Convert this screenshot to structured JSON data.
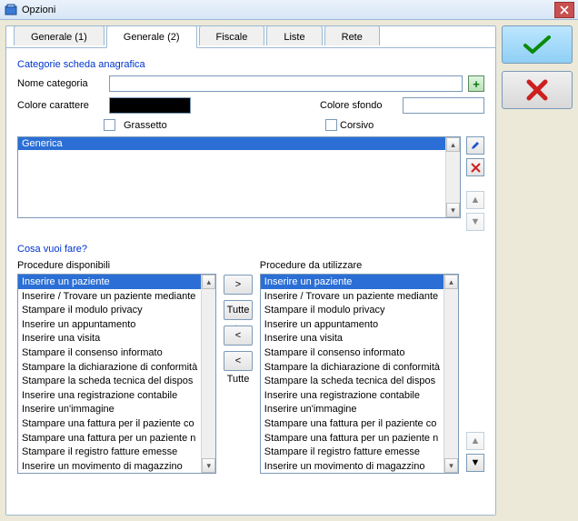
{
  "window": {
    "title": "Opzioni"
  },
  "tabs": [
    "Generale (1)",
    "Generale (2)",
    "Fiscale",
    "Liste",
    "Rete"
  ],
  "active_tab": 1,
  "section_categories_title": "Categorie scheda anagrafica",
  "labels": {
    "nome_categoria": "Nome categoria",
    "colore_carattere": "Colore carattere",
    "colore_sfondo": "Colore sfondo",
    "grassetto": "Grassetto",
    "corsivo": "Corsivo"
  },
  "category_name_value": "",
  "color_char": "#000000",
  "color_bg": "#ffffff",
  "category_list": [
    {
      "label": "Generica",
      "selected": true
    }
  ],
  "section_cosa_title": "Cosa vuoi fare?",
  "available_header": "Procedure disponibili",
  "used_header": "Procedure da utilizzare",
  "move_buttons": {
    "add": ">",
    "add_all": "Tutte >",
    "remove": "<",
    "remove_all": "< Tutte"
  },
  "procedures_available": [
    "Inserire un paziente",
    "Inserire / Trovare un paziente mediante",
    "Stampare il modulo privacy",
    "Inserire un appuntamento",
    "Inserire una visita",
    "Stampare il consenso informato",
    "Stampare la dichiarazione di conformità",
    "Stampare la scheda tecnica del dispos",
    "Inserire una registrazione contabile",
    "Inserire un'immagine",
    "Stampare una fattura per il paziente co",
    "Stampare una fattura per un paziente n",
    "Stampare il registro fatture emesse",
    "Inserire un movimento di magazzino"
  ],
  "procedures_used": [
    "Inserire un paziente",
    "Inserire / Trovare un paziente mediante",
    "Stampare il modulo privacy",
    "Inserire un appuntamento",
    "Inserire una visita",
    "Stampare il consenso informato",
    "Stampare la dichiarazione di conformità",
    "Stampare la scheda tecnica del dispos",
    "Inserire una registrazione contabile",
    "Inserire un'immagine",
    "Stampare una fattura per il paziente co",
    "Stampare una fattura per un paziente n",
    "Stampare il registro fatture emesse",
    "Inserire un movimento di magazzino"
  ],
  "selected_available_index": 0,
  "selected_used_index": 0
}
